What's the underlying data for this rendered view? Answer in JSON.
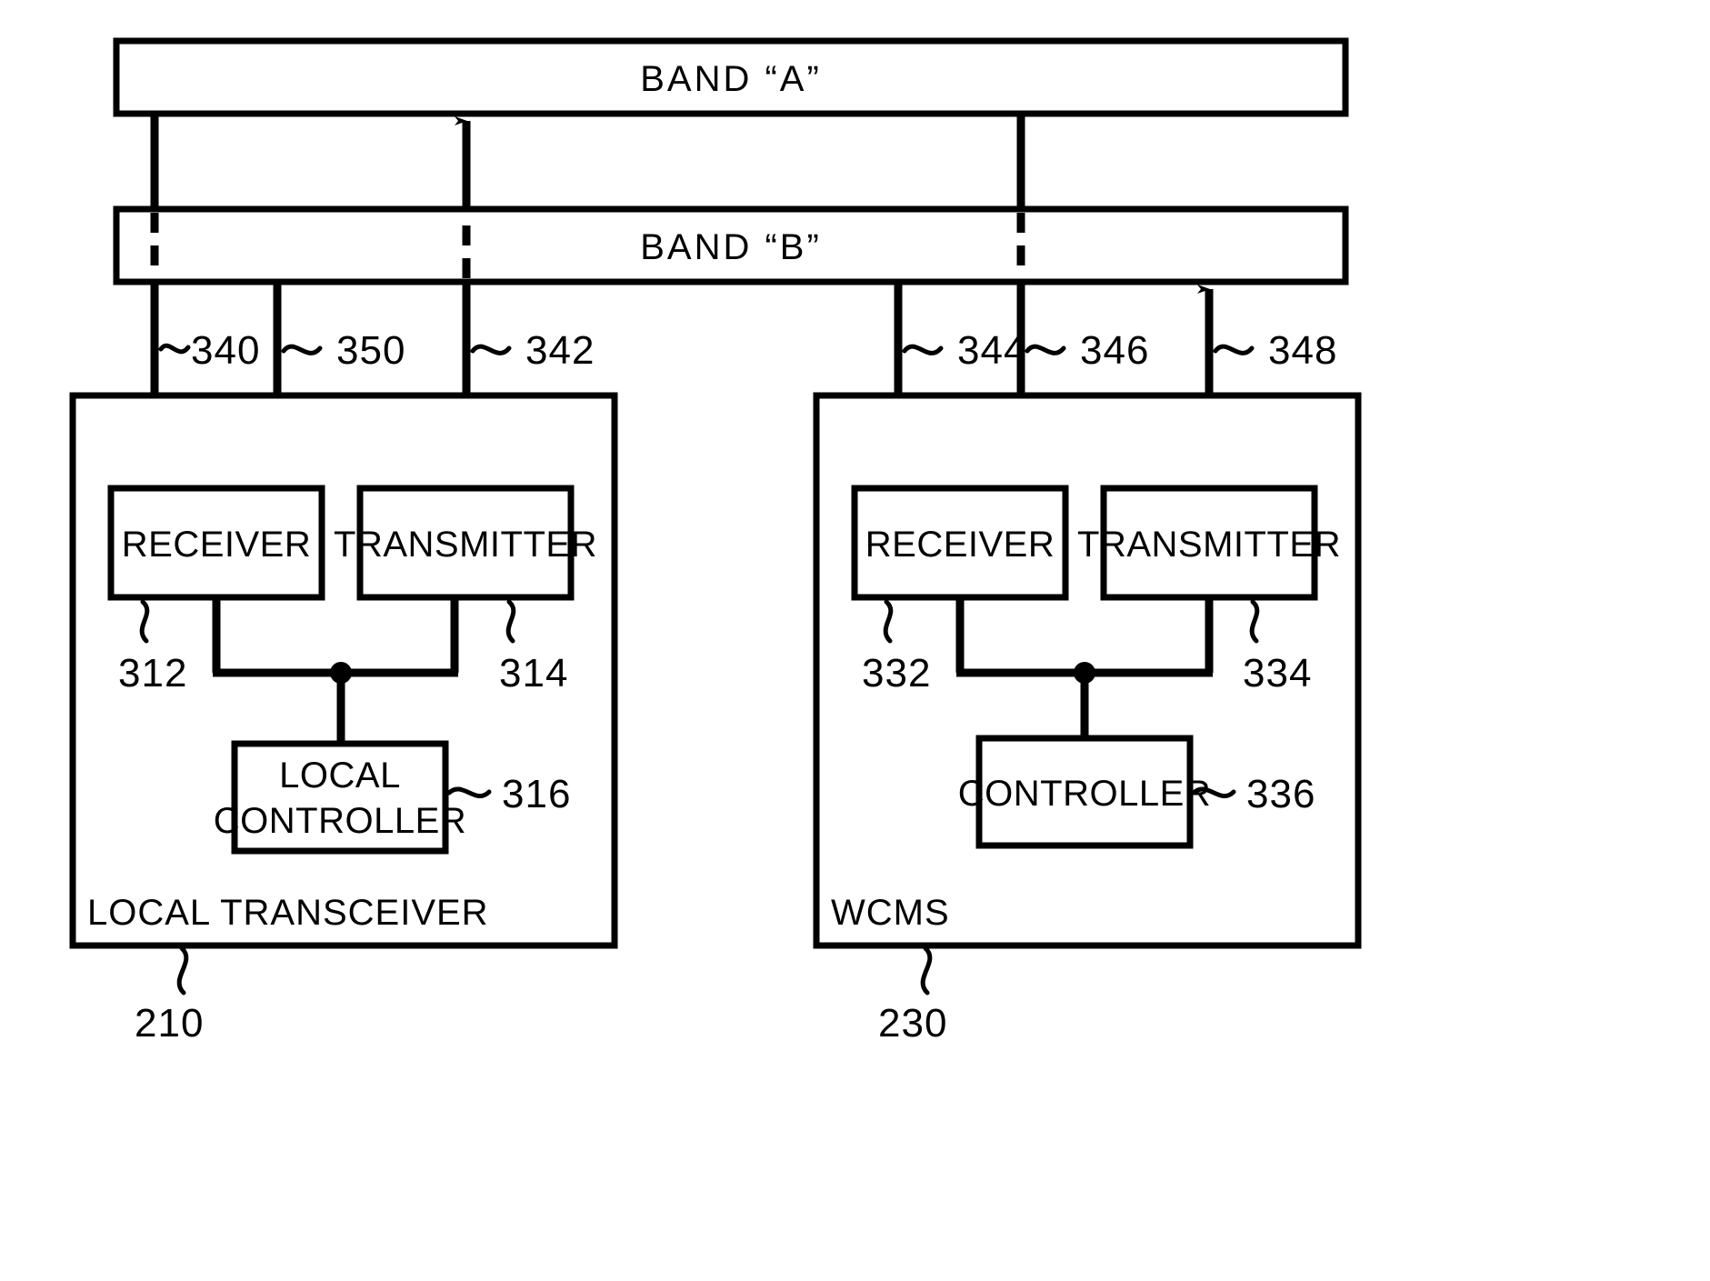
{
  "figure": {
    "type": "patent-block-diagram",
    "background_color": "#ffffff",
    "line_color": "#000000"
  },
  "bands": [
    {
      "id": "band-a",
      "label": "BAND  “A”"
    },
    {
      "id": "band-b",
      "label": "BAND  “B”"
    }
  ],
  "signal_refs": {
    "n340": "340",
    "n350": "350",
    "n342": "342",
    "n344": "344",
    "n346": "346",
    "n348": "348"
  },
  "left_unit": {
    "container_label": "LOCAL  TRANSCEIVER",
    "container_ref": "210",
    "receiver_label": "RECEIVER",
    "receiver_ref": "312",
    "transmitter_label": "TRANSMITTER",
    "transmitter_ref": "314",
    "controller_label_line1": "LOCAL",
    "controller_label_line2": "CONTROLLER",
    "controller_ref": "316"
  },
  "right_unit": {
    "container_label": "WCMS",
    "container_ref": "230",
    "receiver_label": "RECEIVER",
    "receiver_ref": "332",
    "transmitter_label": "TRANSMITTER",
    "transmitter_ref": "334",
    "controller_label": "CONTROLLER",
    "controller_ref": "336"
  }
}
